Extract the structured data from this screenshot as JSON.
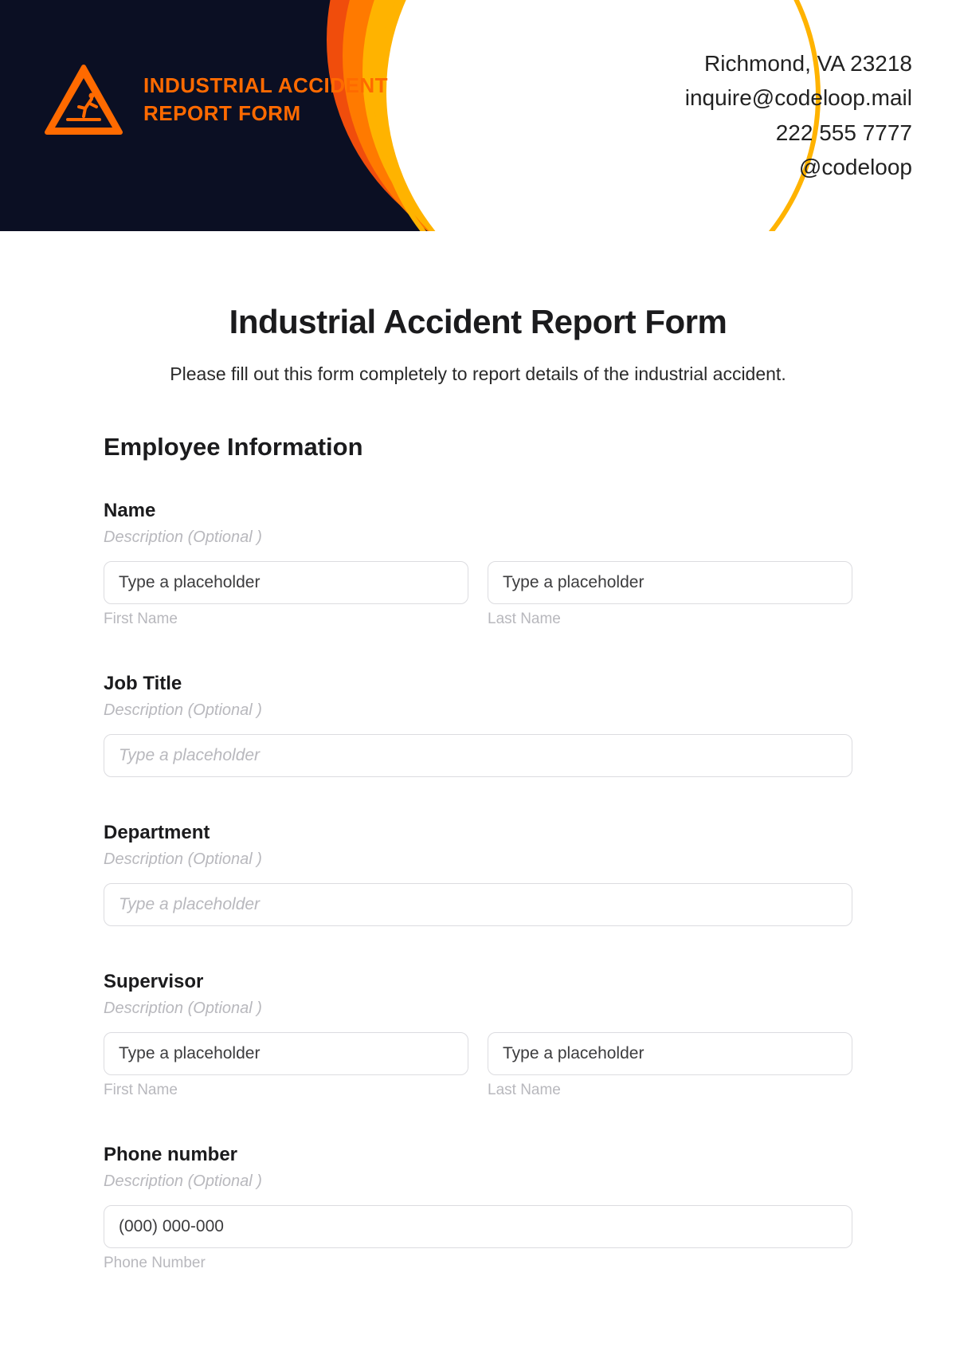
{
  "header": {
    "logo_title_line1": "INDUSTRIAL ACCIDENT",
    "logo_title_line2": "REPORT FORM",
    "contact": {
      "address": "Richmond, VA 23218",
      "email": "inquire@codeloop.mail",
      "phone": "222 555 7777",
      "handle": "@codeloop"
    }
  },
  "main": {
    "title": "Industrial Accident Report Form",
    "intro": "Please fill out this form completely to report details of the industrial accident.",
    "section_employee": "Employee Information",
    "fields": {
      "name": {
        "label": "Name",
        "desc": "Description (Optional )",
        "first_placeholder": "Type a placeholder",
        "last_placeholder": "Type a placeholder",
        "first_sub": "First Name",
        "last_sub": "Last Name"
      },
      "job_title": {
        "label": "Job Title",
        "desc": "Description (Optional )",
        "placeholder": "Type a placeholder"
      },
      "department": {
        "label": "Department",
        "desc": "Description (Optional )",
        "placeholder": "Type a placeholder"
      },
      "supervisor": {
        "label": "Supervisor",
        "desc": "Description (Optional )",
        "first_placeholder": "Type a placeholder",
        "last_placeholder": "Type a placeholder",
        "first_sub": "First Name",
        "last_sub": "Last Name"
      },
      "phone": {
        "label": "Phone number",
        "desc": "Description (Optional )",
        "placeholder": "(000) 000-000",
        "sub": "Phone Number"
      }
    }
  }
}
